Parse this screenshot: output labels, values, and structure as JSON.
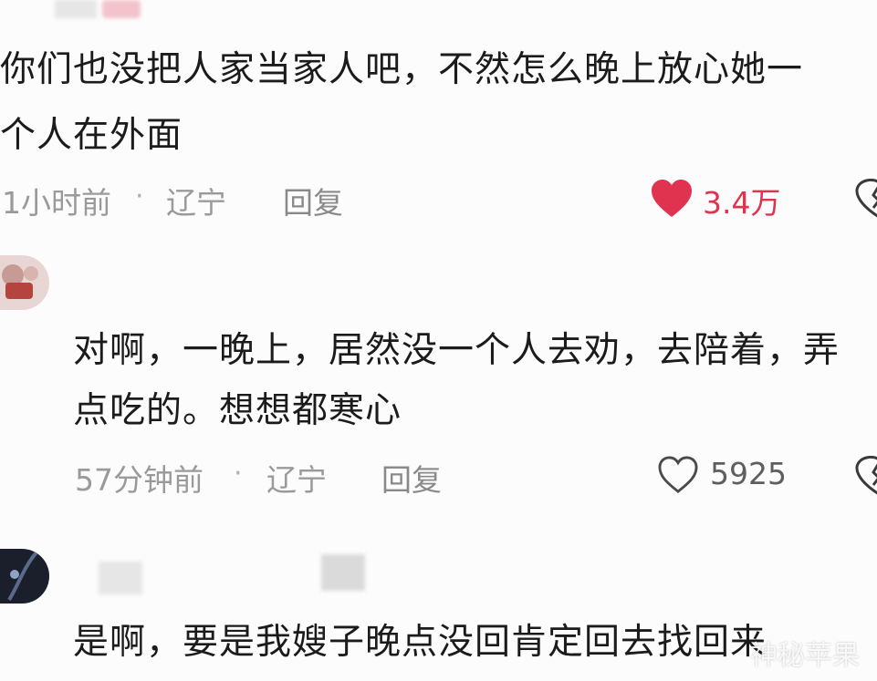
{
  "comments": [
    {
      "text_lines": [
        "你们也没把人家当家人吧，不然怎么晚上放心她一",
        "个人在外面"
      ],
      "time": "1小时前",
      "location": "辽宁",
      "reply_label": "回复",
      "likes": "3.4万",
      "liked": true,
      "like_icon": "heart-filled-icon",
      "dislike_icon": "broken-heart-icon"
    },
    {
      "text_lines": [
        "对啊，一晚上，居然没一个人去劝，去陪着，弄",
        "点吃的。想想都寒心"
      ],
      "time": "57分钟前",
      "location": "辽宁",
      "reply_label": "回复",
      "likes": "5925",
      "liked": false,
      "like_icon": "heart-outline-icon",
      "dislike_icon": "broken-heart-icon"
    },
    {
      "text_lines": [
        "是啊，要是我嫂子晚点没回肯定回去找回来"
      ]
    }
  ],
  "meta_separator": "·",
  "watermark": "神秘苹果",
  "colors": {
    "liked_red": "#e0334f",
    "meta_gray": "#9a9a9a",
    "text": "#1b1b1b"
  }
}
